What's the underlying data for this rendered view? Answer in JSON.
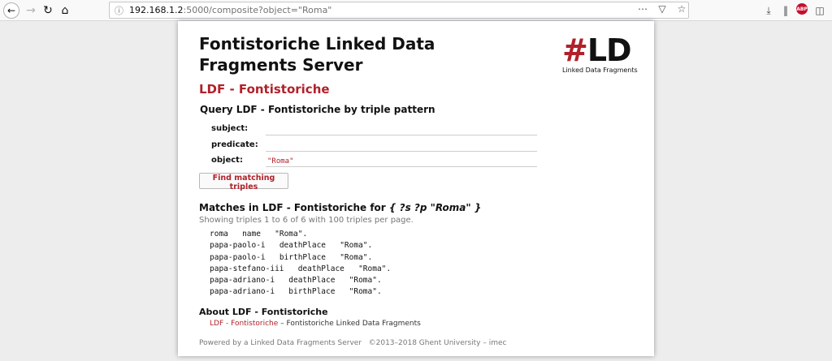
{
  "browser": {
    "url_host": "192.168.1.2",
    "url_rest": ":5000/composite?object=\"Roma\"",
    "icons": [
      "back-icon",
      "forward-icon",
      "reload-icon",
      "home-icon",
      "info-icon",
      "more-icon",
      "pocket-icon",
      "bookmark-star-icon",
      "library-icon",
      "adblock-icon",
      "sidebar-icon"
    ],
    "abp_label": "ABP"
  },
  "header": {
    "title": "Fontistoriche Linked Data Fragments Server",
    "logo_hash": "#",
    "logo_ld": "LD",
    "logo_sub": "Linked Data Fragments"
  },
  "dataset": {
    "title": "LDF - Fontistoriche"
  },
  "query": {
    "title": "Query LDF - Fontistoriche by triple pattern",
    "subject_label": "subject:",
    "subject_value": "",
    "predicate_label": "predicate:",
    "predicate_value": "",
    "object_label": "object:",
    "object_value": "\"Roma\"",
    "button_label": "Find matching triples"
  },
  "matches": {
    "title_prefix": "Matches in LDF - Fontistoriche for ",
    "pattern": "{ ?s ?p \"Roma\" }",
    "showing": "Showing triples 1 to 6 of 6 with 100 triples per page.",
    "triples": [
      {
        "s": "roma",
        "p": "name",
        "o": "\"Roma\"."
      },
      {
        "s": "papa-paolo-i",
        "p": "deathPlace",
        "o": "\"Roma\"."
      },
      {
        "s": "papa-paolo-i",
        "p": "birthPlace",
        "o": "\"Roma\"."
      },
      {
        "s": "papa-stefano-iii",
        "p": "deathPlace",
        "o": "\"Roma\"."
      },
      {
        "s": "papa-adriano-i",
        "p": "deathPlace",
        "o": "\"Roma\"."
      },
      {
        "s": "papa-adriano-i",
        "p": "birthPlace",
        "o": "\"Roma\"."
      }
    ]
  },
  "about": {
    "title": "About LDF - Fontistoriche",
    "link": "LDF - Fontistoriche",
    "description": " – Fontistoriche Linked Data Fragments"
  },
  "footer": {
    "powered": "Powered by a Linked Data Fragments Server",
    "copyright": "©2013–2018 Ghent University – imec"
  },
  "colors": {
    "accent": "#b0212a",
    "text": "#111111",
    "muted": "#777777"
  }
}
